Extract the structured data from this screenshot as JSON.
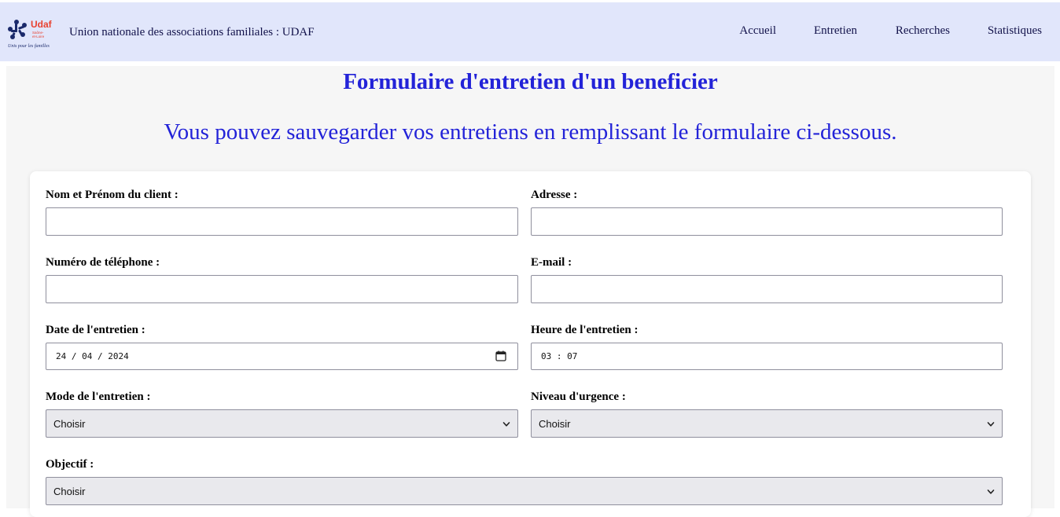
{
  "header": {
    "brand": "Union nationale des associations familiales : UDAF",
    "logo": {
      "name": "Udaf",
      "region": "Saône-et-Loire",
      "tagline": "Unis pour les familles"
    },
    "nav": [
      "Accueil",
      "Entretien",
      "Recherches",
      "Statistiques"
    ]
  },
  "page": {
    "title": "Formulaire d'entretien d'un beneficier",
    "subtitle": "Vous pouvez sauvegarder vos entretiens en remplissant le formulaire ci-dessous."
  },
  "form": {
    "name_label": "Nom et Prénom du client :",
    "name_value": "",
    "address_label": "Adresse :",
    "address_value": "",
    "phone_label": "Numéro de téléphone :",
    "phone_value": "",
    "email_label": "E-mail :",
    "email_value": "",
    "date_label": "Date de l'entretien :",
    "date_value": "24 / 04 / 2024",
    "time_label": "Heure de l'entretien :",
    "time_value": "03 : 07",
    "mode_label": "Mode de l'entretien :",
    "mode_value": "Choisir",
    "urgency_label": "Niveau d'urgence :",
    "urgency_value": "Choisir",
    "objective_label": "Objectif :",
    "objective_value": "Choisir"
  },
  "colors": {
    "header_bg": "#e1e6fb",
    "title": "#2323d8",
    "logo_red": "#e8412f",
    "logo_navy": "#1b2a6b"
  }
}
